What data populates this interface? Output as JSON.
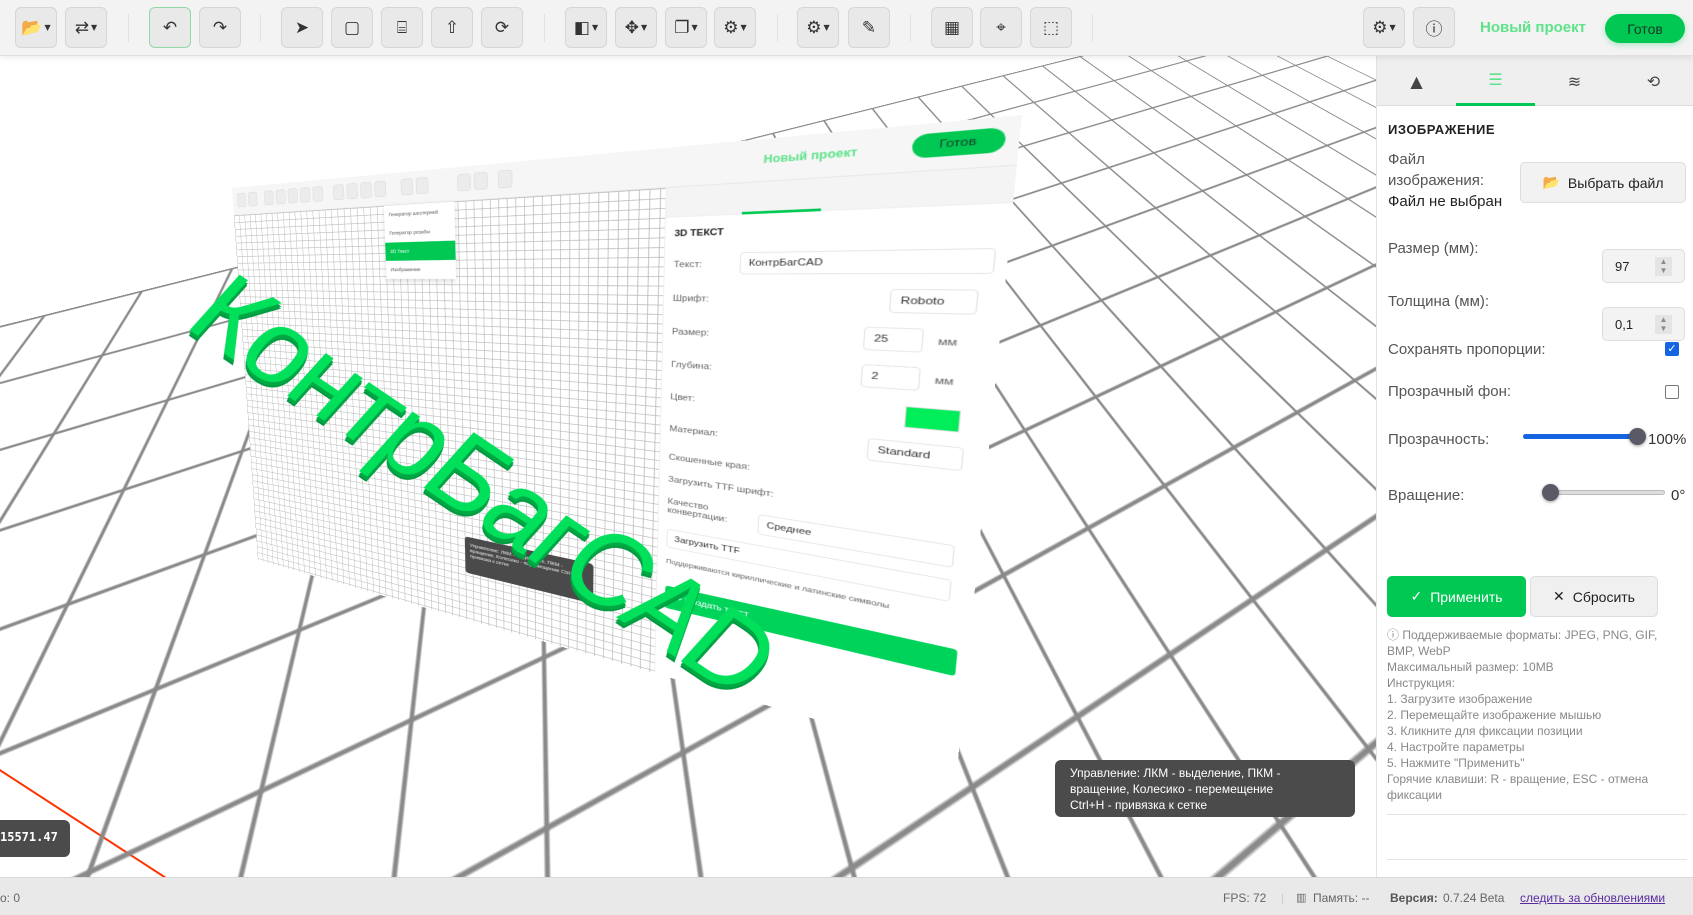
{
  "toolbar": {
    "buttons": [
      {
        "icon": "folder-open-icon",
        "glyph": "📂",
        "caret": true
      },
      {
        "icon": "swap-icon",
        "glyph": "⇄",
        "caret": true
      },
      {
        "icon": "undo-icon",
        "glyph": "↶"
      },
      {
        "icon": "redo-icon",
        "glyph": "↷"
      },
      {
        "icon": "pointer-icon",
        "glyph": "➤"
      },
      {
        "icon": "square-icon",
        "glyph": "▢"
      },
      {
        "icon": "tools-icon",
        "glyph": "⌸"
      },
      {
        "icon": "arrow-up-icon",
        "glyph": "⇧"
      },
      {
        "icon": "sync-icon",
        "glyph": "⟳"
      },
      {
        "icon": "shapes-icon",
        "glyph": "◧",
        "caret": true
      },
      {
        "icon": "move-icon",
        "glyph": "✥",
        "caret": true
      },
      {
        "icon": "copy-icon",
        "glyph": "❐",
        "caret": true
      },
      {
        "icon": "cogs-icon",
        "glyph": "⚙",
        "caret": true
      },
      {
        "icon": "gear-icon",
        "glyph": "⚙",
        "caret": true
      },
      {
        "icon": "ruler-icon",
        "glyph": "✎"
      },
      {
        "icon": "grid-icon",
        "glyph": "▦"
      },
      {
        "icon": "crosshair-icon",
        "glyph": "⌖"
      },
      {
        "icon": "frame-icon",
        "glyph": "⬚"
      }
    ],
    "settings_icon": "gear-icon",
    "info_icon": "info-icon",
    "project_name": "Новый проект",
    "ready_label": "Готов"
  },
  "panel": {
    "tabs": [
      {
        "icon": "shapes-icon",
        "glyph": "▲"
      },
      {
        "icon": "sliders-icon",
        "glyph": "☰",
        "active": true
      },
      {
        "icon": "layers-icon",
        "glyph": "≋"
      },
      {
        "icon": "history-icon",
        "glyph": "⟲"
      }
    ],
    "title": "ИЗОБРАЖЕНИЕ",
    "file_label_1": "Файл",
    "file_label_2": "изображения:",
    "file_status": "Файл не выбран",
    "choose_file": "Выбрать файл",
    "size_label": "Размер (мм):",
    "size_value": "97",
    "thickness_label": "Толщина (мм):",
    "thickness_value": "0,1",
    "keep_ratio_label": "Сохранять пропорции:",
    "keep_ratio": true,
    "transparent_bg_label": "Прозрачный фон:",
    "transparent_bg": false,
    "opacity_label": "Прозрачность:",
    "opacity_value": "100%",
    "opacity": 1.0,
    "rotation_label": "Вращение:",
    "rotation_value": "0°",
    "rotation": 0,
    "apply": "Применить",
    "reset": "Сбросить",
    "info_lines": [
      "Поддерживаемые форматы: JPEG, PNG, GIF, BMP, WebP",
      "Максимальный размер: 10MB",
      "Инструкция:",
      "1. Загрузите изображение",
      "2. Перемещайте изображение мышью",
      "3. Кликните для фиксации позиции",
      "4. Настройте параметры",
      "5. Нажмите \"Применить\"",
      "Горячие клавиши: R - вращение, ESC - отмена фиксации"
    ]
  },
  "viewport": {
    "tooltip_lines": [
      "Управление: ЛКМ - выделение, ПКМ -",
      "вращение, Колесико - перемещение",
      "Ctrl+H - привязка к сетке"
    ],
    "coordinate": "15571.47",
    "image_plane": {
      "text3d": "КонтрБагCAD",
      "project_name": "Новый проект",
      "ready_label": "Готов",
      "menu": [
        "Генератор шестерней",
        "Генератор резьбы",
        "3D Текст",
        "Изображение"
      ],
      "panel_title": "3D ТЕКСТ",
      "text_label": "Текст:",
      "text_value": "КонтрБагCAD",
      "font_label": "Шрифт:",
      "font_value": "Roboto",
      "size_label": "Размер:",
      "size_value": "25",
      "unit": "мм",
      "depth_label": "Глубина:",
      "depth_value": "2",
      "color_label": "Цвет:",
      "color": "#00ee5a",
      "material_label": "Материал:",
      "material_value": "Standard",
      "bevel_label": "Скошенные края:",
      "ttf_label": "Загрузить TTF шрифт:",
      "quality_label": "Качество конвертации:",
      "quality_value": "Среднее",
      "upload_ttf": "Загрузить TTF",
      "hint": "Поддерживаются кириллические и латинские символы",
      "create": "+ Создать текст",
      "tooltip": "Управление: ЛКМ - выделение, ПКМ - вращение, Колесико - перемещение Ctrl+H - привязка к сетке"
    }
  },
  "status": {
    "left": "o: 0",
    "fps": "FPS: 72",
    "memory_icon": "memory-icon",
    "memory": "Память: --",
    "version_label": "Версия:",
    "version": "0.7.24 Beta",
    "updates_link": "следить за обновлениями"
  },
  "colors": {
    "accent": "#00c853",
    "project_name": "#5ee38a",
    "slider": "#1565e0"
  }
}
